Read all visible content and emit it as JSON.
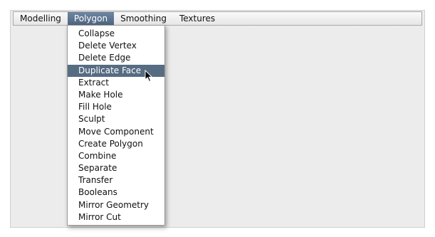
{
  "menubar": {
    "items": [
      {
        "label": "Modelling"
      },
      {
        "label": "Polygon"
      },
      {
        "label": "Smoothing"
      },
      {
        "label": "Textures"
      }
    ],
    "active_index": 1
  },
  "dropdown": {
    "items": [
      {
        "label": "Collapse"
      },
      {
        "label": "Delete Vertex"
      },
      {
        "label": "Delete Edge"
      },
      {
        "label": "Duplicate Face"
      },
      {
        "label": "Extract"
      },
      {
        "label": "Make Hole"
      },
      {
        "label": "Fill Hole"
      },
      {
        "label": "Sculpt"
      },
      {
        "label": "Move Component"
      },
      {
        "label": "Create Polygon"
      },
      {
        "label": "Combine"
      },
      {
        "label": "Separate"
      },
      {
        "label": "Transfer"
      },
      {
        "label": "Booleans"
      },
      {
        "label": "Mirror Geometry"
      },
      {
        "label": "Mirror Cut"
      }
    ],
    "highlighted_index": 3
  },
  "pointer": {
    "icon": "arrow-cursor-icon"
  },
  "colors": {
    "highlight": "#566c82",
    "active_menu": "#5a7290",
    "background": "#ececec"
  }
}
